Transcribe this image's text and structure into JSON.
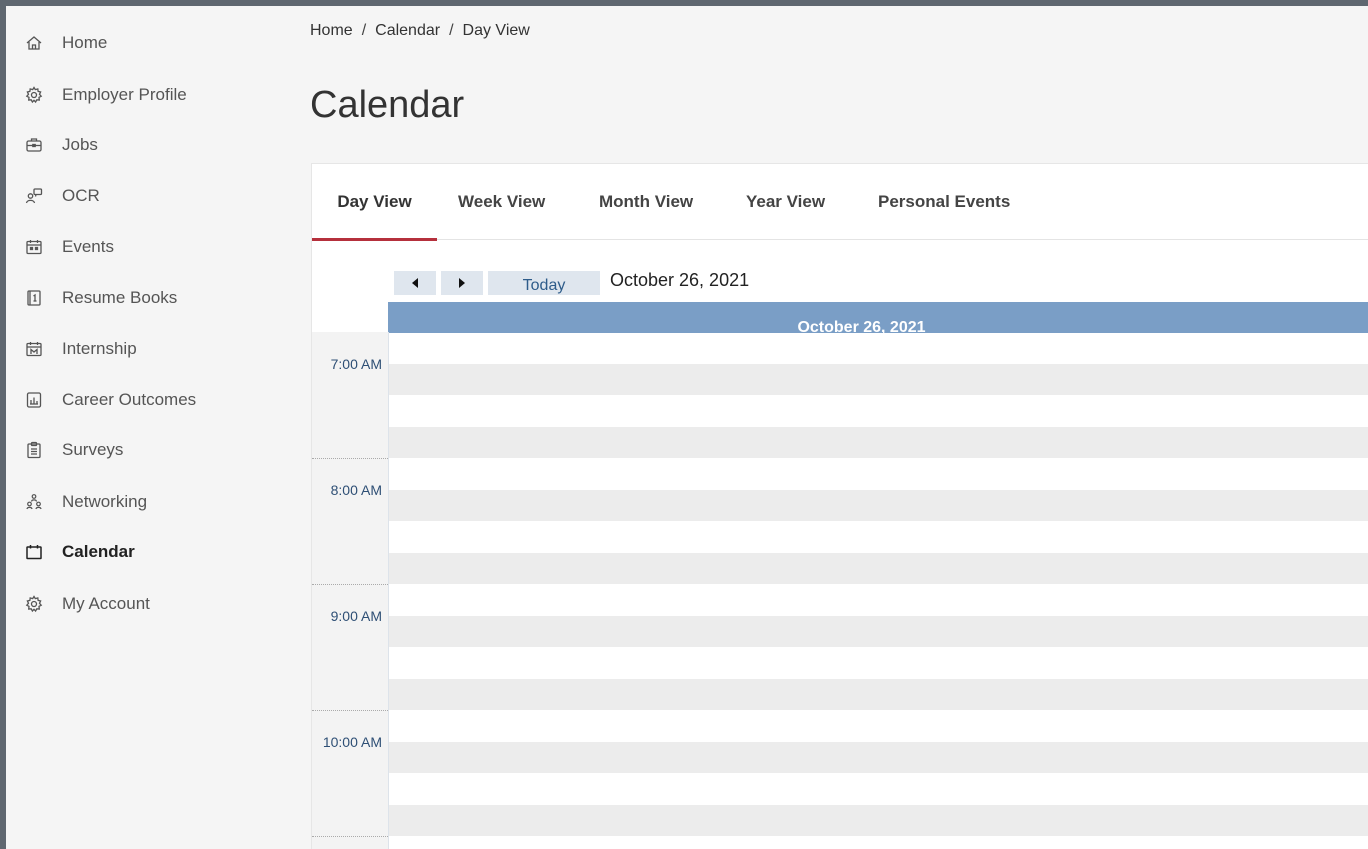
{
  "sidebar": {
    "items": [
      {
        "label": "Home",
        "icon": "home-icon",
        "active": false
      },
      {
        "label": "Employer Profile",
        "icon": "gear-icon",
        "active": false
      },
      {
        "label": "Jobs",
        "icon": "briefcase-icon",
        "active": false
      },
      {
        "label": "OCR",
        "icon": "ocr-icon",
        "active": false
      },
      {
        "label": "Events",
        "icon": "events-calendar-icon",
        "active": false
      },
      {
        "label": "Resume Books",
        "icon": "resume-book-icon",
        "active": false
      },
      {
        "label": "Internship",
        "icon": "internship-icon",
        "active": false
      },
      {
        "label": "Career Outcomes",
        "icon": "chart-doc-icon",
        "active": false
      },
      {
        "label": "Surveys",
        "icon": "clipboard-icon",
        "active": false
      },
      {
        "label": "Networking",
        "icon": "people-network-icon",
        "active": false
      },
      {
        "label": "Calendar",
        "icon": "calendar-icon",
        "active": true
      },
      {
        "label": "My Account",
        "icon": "gear-icon",
        "active": false
      }
    ]
  },
  "breadcrumb": {
    "home": "Home",
    "calendar": "Calendar",
    "current": "Day View",
    "separator": "/"
  },
  "page": {
    "title": "Calendar"
  },
  "tabs": [
    {
      "label": "Day View",
      "active": true
    },
    {
      "label": "Week View",
      "active": false
    },
    {
      "label": "Month View",
      "active": false
    },
    {
      "label": "Year View",
      "active": false
    },
    {
      "label": "Personal Events",
      "active": false
    }
  ],
  "calendar": {
    "today_label": "Today",
    "prev_icon": "triangle-left-icon",
    "next_icon": "triangle-right-icon",
    "date_label": "October 26, 2021",
    "day_header": "October 26, 2021",
    "hours": [
      "7:00 AM",
      "8:00 AM",
      "9:00 AM",
      "10:00 AM"
    ]
  },
  "colors": {
    "accent": "#b5303c",
    "day_header_bg": "#7a9ec6",
    "time_label": "#2e4f75",
    "today_text": "#2e5c8a"
  }
}
